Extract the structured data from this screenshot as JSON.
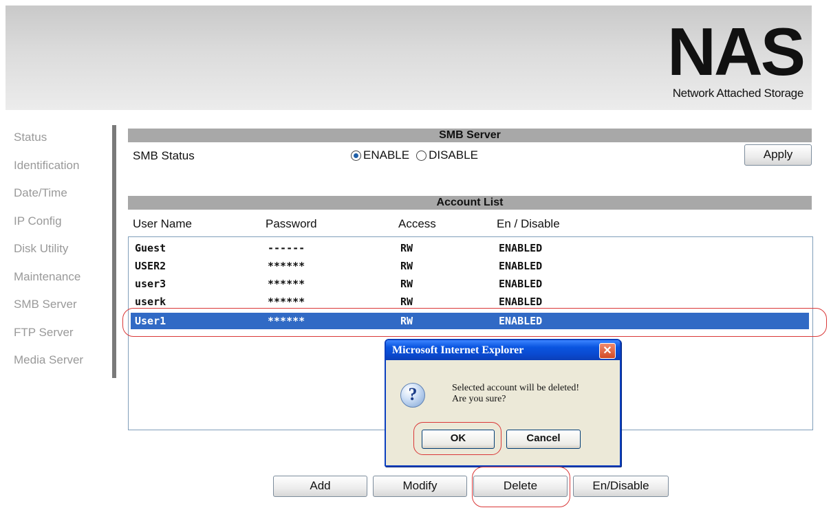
{
  "header": {
    "logo_text": "NAS",
    "logo_subtitle": "Network Attached Storage"
  },
  "sidebar": {
    "items": [
      {
        "label": "Status"
      },
      {
        "label": "Identification"
      },
      {
        "label": "Date/Time"
      },
      {
        "label": "IP Config"
      },
      {
        "label": "Disk Utility"
      },
      {
        "label": "Maintenance"
      },
      {
        "label": "SMB Server"
      },
      {
        "label": "FTP Server"
      },
      {
        "label": "Media Server"
      }
    ]
  },
  "smb": {
    "section_title": "SMB Server",
    "status_label": "SMB Status",
    "enable_label": "ENABLE",
    "disable_label": "DISABLE",
    "selected": "ENABLE",
    "apply_label": "Apply"
  },
  "accounts": {
    "section_title": "Account List",
    "columns": [
      "User Name",
      "Password",
      "Access",
      "En / Disable"
    ],
    "rows": [
      {
        "user": "Guest",
        "password": "------",
        "access": "RW",
        "status": "ENABLED"
      },
      {
        "user": "USER2",
        "password": "******",
        "access": "RW",
        "status": "ENABLED"
      },
      {
        "user": "user3",
        "password": "******",
        "access": "RW",
        "status": "ENABLED"
      },
      {
        "user": "userk",
        "password": "******",
        "access": "RW",
        "status": "ENABLED"
      },
      {
        "user": "User1",
        "password": "******",
        "access": "RW",
        "status": "ENABLED"
      }
    ],
    "selected_row": 4
  },
  "actions": {
    "add_label": "Add",
    "modify_label": "Modify",
    "delete_label": "Delete",
    "endisable_label": "En/Disable"
  },
  "dialog": {
    "title": "Microsoft Internet Explorer",
    "close_glyph": "✕",
    "icon": "question-icon",
    "icon_glyph": "?",
    "message_line1": "Selected account will be deleted!",
    "message_line2": "Are you sure?",
    "ok_label": "OK",
    "cancel_label": "Cancel"
  },
  "colors": {
    "selection": "#316ac5",
    "section_bar": "#a8a8a8",
    "annotation_ring": "#d93636",
    "dialog_title": "#0a55e0"
  }
}
